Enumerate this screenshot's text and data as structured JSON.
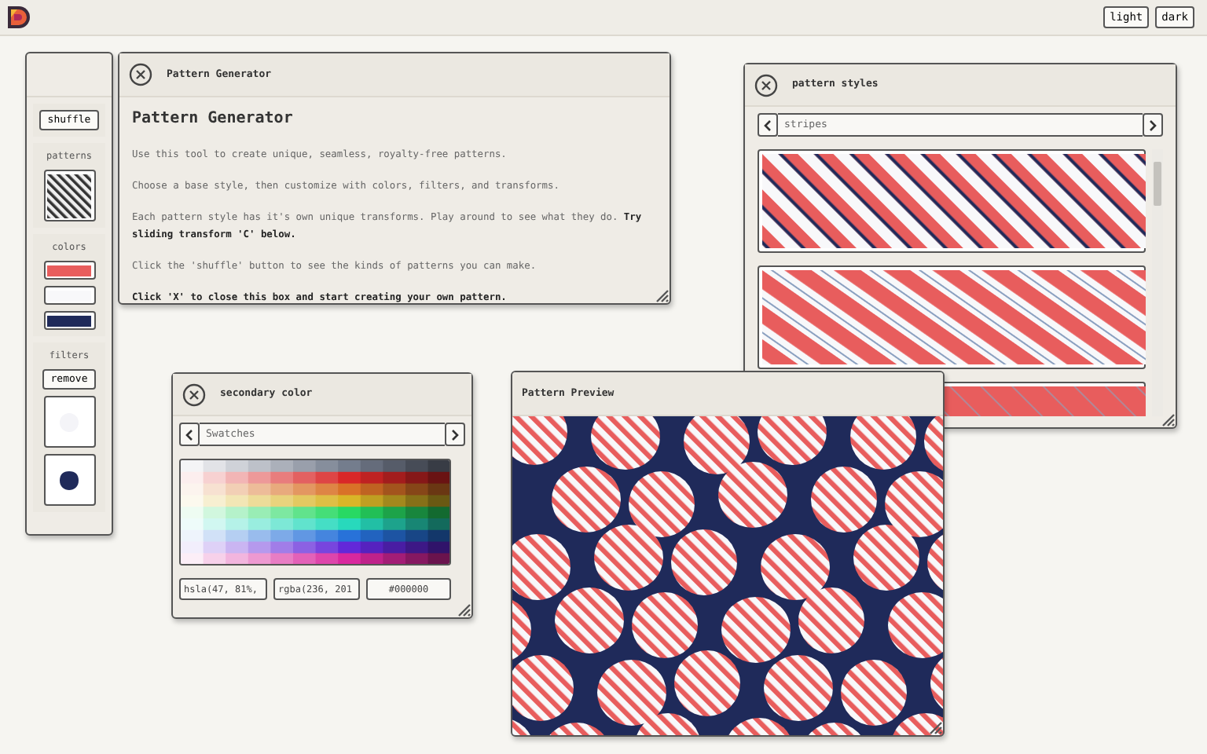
{
  "topbar": {
    "theme_buttons": [
      {
        "label": "light"
      },
      {
        "label": "dark"
      }
    ]
  },
  "sidebar": {
    "shuffle": "shuffle",
    "patterns_label": "patterns",
    "colors_label": "colors",
    "colors": [
      {
        "color": "#e85d5d"
      },
      {
        "color": "#f8f8fa"
      },
      {
        "color": "#1f2a5a"
      }
    ],
    "filters_label": "filters",
    "remove": "remove"
  },
  "generator": {
    "title": "Pattern Generator",
    "heading": "Pattern Generator",
    "paragraphs": [
      {
        "kind": "text",
        "text": "Use this tool to create unique, seamless, royalty-free patterns."
      },
      {
        "kind": "text",
        "text": "Choose a base style, then customize with colors, filters, and transforms."
      },
      {
        "kind": "text",
        "text": "Each pattern style has it's own unique transforms. Play around to see what they do. **Try sliding transform 'C' below.**"
      },
      {
        "kind": "text",
        "text": "Click the 'shuffle' button to see the kinds of patterns you can make."
      },
      {
        "kind": "note",
        "text": "Click 'X' to close this box and start creating your own pattern."
      }
    ]
  },
  "styles": {
    "title": "pattern styles",
    "selector": "stripes"
  },
  "color_window": {
    "title": "secondary color",
    "selector": "Swatches",
    "fields": [
      "hsla(47, 81%,",
      "rgba(236, 201",
      "#000000"
    ]
  },
  "preview": {
    "title": "Pattern Preview"
  }
}
